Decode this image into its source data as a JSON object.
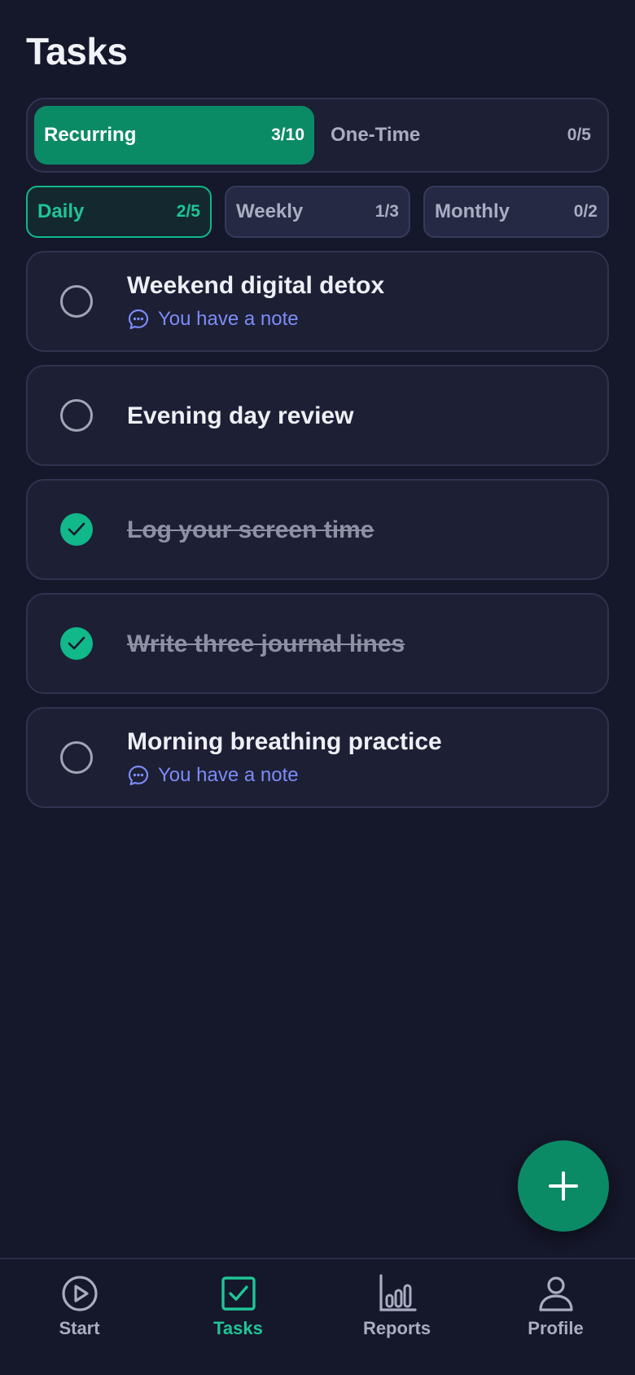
{
  "header": {
    "title": "Tasks"
  },
  "segments": [
    {
      "label": "Recurring",
      "count": "3/10",
      "active": true
    },
    {
      "label": "One-Time",
      "count": "0/5",
      "active": false
    }
  ],
  "filters": [
    {
      "label": "Daily",
      "count": "2/5",
      "active": true
    },
    {
      "label": "Weekly",
      "count": "1/3",
      "active": false
    },
    {
      "label": "Monthly",
      "count": "0/2",
      "active": false
    }
  ],
  "tasks": [
    {
      "title": "Weekend digital detox",
      "done": false,
      "note": "You have a note"
    },
    {
      "title": "Evening day review",
      "done": false
    },
    {
      "title": "Log your screen time",
      "done": true
    },
    {
      "title": "Write three journal lines",
      "done": true
    },
    {
      "title": "Morning breathing practice",
      "done": false,
      "note": "You have a note"
    }
  ],
  "fab": {
    "icon": "plus-icon"
  },
  "tabbar": [
    {
      "label": "Start",
      "icon": "play-circle-icon",
      "active": false
    },
    {
      "label": "Tasks",
      "icon": "checkbox-icon",
      "active": true
    },
    {
      "label": "Reports",
      "icon": "bar-chart-icon",
      "active": false
    },
    {
      "label": "Profile",
      "icon": "user-icon",
      "active": false
    }
  ],
  "colors": {
    "background": "#15172a",
    "accent": "#0b8a66",
    "accent_text": "#1fc596",
    "note": "#7c8cf5"
  }
}
